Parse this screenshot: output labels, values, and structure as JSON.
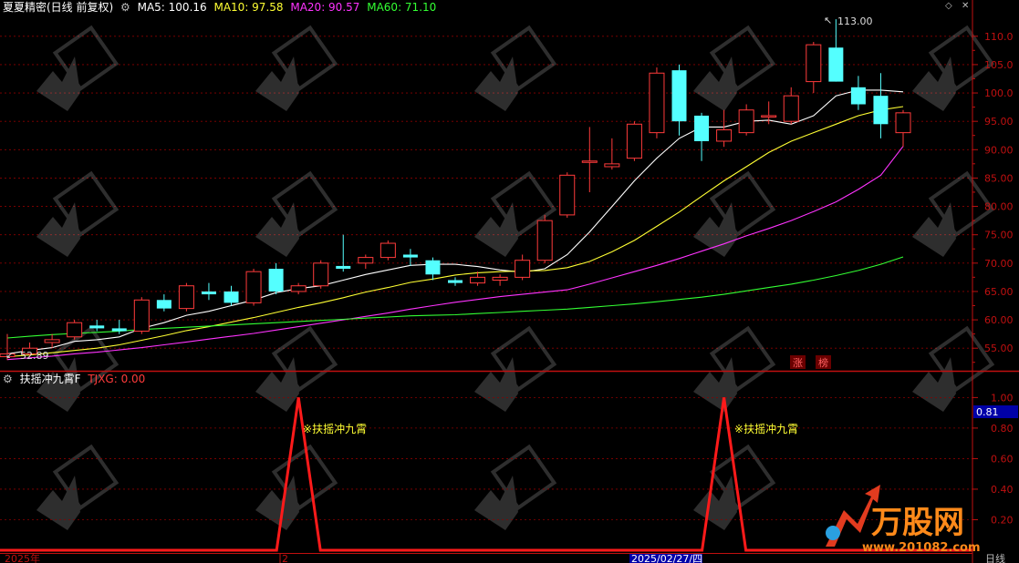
{
  "title": "夏夏精密(日线 前复权)",
  "ma": [
    {
      "label": "MA5: 100.16",
      "color": "#ffffff",
      "value": 100.16
    },
    {
      "label": "MA10: 97.58",
      "color": "#ffff33",
      "value": 97.58
    },
    {
      "label": "MA20: 90.57",
      "color": "#ff33ff",
      "value": 90.57
    },
    {
      "label": "MA60: 71.10",
      "color": "#33ff33",
      "value": 71.1
    }
  ],
  "main_yaxis": {
    "ticks": [
      "110.0",
      "105.0",
      "100.0",
      "95.00",
      "90.00",
      "85.00",
      "80.00",
      "75.00",
      "70.00",
      "65.00",
      "60.00",
      "55.00"
    ],
    "min": 51.5,
    "max": 113.5
  },
  "annotations": {
    "high": "113.00",
    "low": "52.89",
    "zhang": "涨",
    "bang": "榜"
  },
  "indicator": {
    "name": "扶摇冲九霄F",
    "value_label": "TJXG: 0.00",
    "signal_text": "扶摇冲九霄",
    "current": "0.81",
    "yticks": [
      "1.00",
      "0.80",
      "0.60",
      "0.40",
      "0.20"
    ]
  },
  "footer": {
    "left": "2025年",
    "mid": "2",
    "date": "2025/02/27/四",
    "right": "日线"
  },
  "logo": {
    "brand": "万股网",
    "url": "www.201082.com"
  },
  "colors": {
    "up": "#ff3b3b",
    "down": "#54ffff",
    "grid": "#8a0000",
    "axis": "#c01010",
    "signal": "#ff1a1a"
  },
  "chart_data": {
    "type": "candlestick",
    "ylim": [
      51.5,
      113.5
    ],
    "ohlc": [
      [
        53.5,
        57.5,
        52.9,
        54.0
      ],
      [
        54.0,
        56.0,
        53.5,
        55.0
      ],
      [
        56.0,
        57.5,
        55.0,
        56.5
      ],
      [
        57.0,
        60.0,
        56.5,
        59.5
      ],
      [
        59.0,
        60.0,
        58.0,
        58.5
      ],
      [
        58.5,
        60.0,
        57.5,
        58.0
      ],
      [
        58.0,
        64.0,
        57.5,
        63.5
      ],
      [
        63.5,
        64.5,
        61.5,
        62.0
      ],
      [
        62.0,
        66.5,
        61.5,
        66.0
      ],
      [
        65.0,
        66.5,
        63.5,
        64.5
      ],
      [
        65.0,
        66.0,
        62.5,
        63.0
      ],
      [
        63.0,
        69.0,
        62.5,
        68.5
      ],
      [
        69.0,
        70.0,
        64.5,
        65.0
      ],
      [
        65.0,
        66.5,
        64.5,
        66.0
      ],
      [
        66.0,
        70.5,
        65.5,
        70.0
      ],
      [
        69.5,
        75.0,
        68.5,
        69.0
      ],
      [
        70.0,
        71.5,
        69.0,
        71.0
      ],
      [
        71.0,
        74.0,
        70.5,
        73.5
      ],
      [
        71.5,
        72.5,
        69.5,
        71.0
      ],
      [
        70.5,
        71.0,
        67.0,
        68.0
      ],
      [
        67.0,
        67.5,
        66.0,
        66.5
      ],
      [
        66.5,
        68.5,
        66.0,
        67.5
      ],
      [
        67.0,
        68.0,
        66.0,
        67.5
      ],
      [
        67.5,
        71.5,
        67.0,
        70.5
      ],
      [
        70.5,
        78.5,
        70.0,
        77.5
      ],
      [
        78.5,
        86.0,
        78.0,
        85.5
      ],
      [
        88.0,
        94.0,
        82.5,
        88.0
      ],
      [
        87.0,
        92.0,
        86.5,
        87.5
      ],
      [
        88.5,
        95.0,
        88.0,
        94.5
      ],
      [
        93.0,
        104.5,
        92.0,
        103.5
      ],
      [
        104.0,
        105.0,
        92.5,
        95.0
      ],
      [
        96.0,
        96.5,
        88.0,
        91.5
      ],
      [
        91.5,
        97.0,
        90.5,
        93.5
      ],
      [
        93.0,
        98.0,
        92.5,
        97.0
      ],
      [
        96.0,
        98.5,
        94.5,
        96.0
      ],
      [
        95.0,
        101.0,
        94.5,
        99.5
      ],
      [
        102.0,
        109.0,
        100.0,
        108.5
      ],
      [
        108.0,
        113.0,
        102.0,
        102.0
      ],
      [
        101.0,
        103.0,
        97.0,
        98.0
      ],
      [
        99.5,
        103.5,
        92.0,
        94.5
      ],
      [
        93.0,
        97.0,
        90.5,
        96.5
      ]
    ],
    "series": [
      {
        "name": "MA5",
        "values": [
          54.0,
          54.6,
          55.1,
          56.2,
          56.5,
          57.0,
          58.5,
          59.5,
          60.8,
          61.5,
          62.5,
          63.5,
          64.8,
          65.5,
          66.0,
          67.0,
          68.0,
          68.8,
          69.6,
          69.8,
          69.8,
          69.4,
          68.8,
          68.4,
          69.0,
          71.5,
          75.5,
          80.0,
          84.5,
          88.5,
          92.0,
          94.0,
          94.0,
          95.0,
          95.2,
          94.5,
          96.0,
          99.5,
          100.5,
          100.5,
          100.2
        ]
      },
      {
        "name": "MA10",
        "values": [
          53.5,
          53.8,
          54.2,
          54.6,
          55.0,
          55.6,
          56.4,
          57.2,
          58.1,
          58.8,
          59.6,
          60.4,
          61.3,
          62.2,
          63.0,
          63.9,
          64.9,
          65.7,
          66.6,
          67.2,
          67.9,
          68.3,
          68.5,
          68.6,
          68.7,
          69.2,
          70.3,
          72.0,
          74.0,
          76.5,
          79.0,
          81.8,
          84.5,
          87.0,
          89.5,
          91.5,
          93.0,
          94.5,
          96.0,
          97.0,
          97.6
        ]
      },
      {
        "name": "MA20",
        "values": [
          53.0,
          53.3,
          53.6,
          54.0,
          54.3,
          54.7,
          55.1,
          55.6,
          56.1,
          56.6,
          57.1,
          57.6,
          58.2,
          58.8,
          59.4,
          60.0,
          60.6,
          61.2,
          61.9,
          62.5,
          63.1,
          63.6,
          64.1,
          64.5,
          64.9,
          65.3,
          66.3,
          67.4,
          68.5,
          69.6,
          70.8,
          72.1,
          73.4,
          74.8,
          76.1,
          77.5,
          79.1,
          80.8,
          83.0,
          85.5,
          90.6
        ]
      },
      {
        "name": "MA60",
        "values": [
          56.8,
          57.1,
          57.4,
          57.6,
          57.8,
          58.0,
          58.3,
          58.5,
          58.7,
          58.9,
          59.1,
          59.3,
          59.5,
          59.7,
          59.9,
          60.1,
          60.3,
          60.5,
          60.7,
          60.8,
          60.9,
          61.1,
          61.3,
          61.5,
          61.7,
          61.9,
          62.2,
          62.5,
          62.8,
          63.2,
          63.6,
          64.0,
          64.5,
          65.1,
          65.7,
          66.3,
          67.0,
          67.8,
          68.7,
          69.8,
          71.1
        ]
      }
    ],
    "signal": {
      "name": "TJXG",
      "ylim": [
        0,
        1.05
      ],
      "peaks": [
        13,
        32
      ]
    }
  }
}
